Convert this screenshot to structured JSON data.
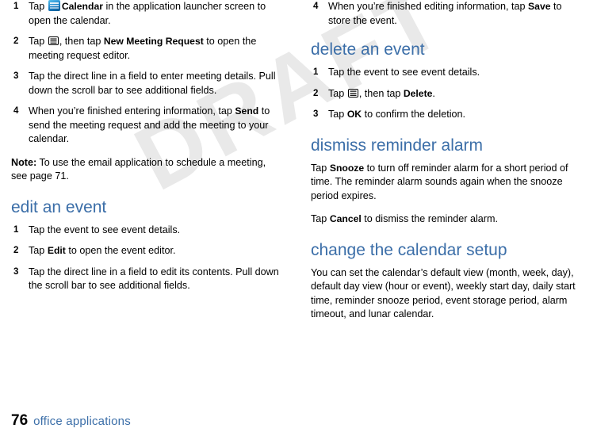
{
  "watermark": "DRAFT",
  "footer": {
    "page_number": "76",
    "label": "office applications"
  },
  "left_column": {
    "steps_schedule_meeting": [
      {
        "num": "1",
        "parts": [
          {
            "t": "Tap ",
            "b": false
          },
          {
            "t": "calendar-icon",
            "b": false,
            "icon": true
          },
          {
            "t": "Calendar",
            "b": true
          },
          {
            "t": " in the application launcher screen to open the calendar.",
            "b": false
          }
        ]
      },
      {
        "num": "2",
        "parts": [
          {
            "t": "Tap ",
            "b": false
          },
          {
            "t": "menu-icon",
            "b": false,
            "menuicon": true
          },
          {
            "t": ", then tap ",
            "b": false
          },
          {
            "t": "New Meeting Request",
            "b": true
          },
          {
            "t": " to open the meeting request editor.",
            "b": false
          }
        ]
      },
      {
        "num": "3",
        "parts": [
          {
            "t": "Tap the direct line in a field to enter meeting details. Pull down the scroll bar to see additional fields.",
            "b": false
          }
        ]
      },
      {
        "num": "4",
        "parts": [
          {
            "t": "When you’re finished entering information, tap ",
            "b": false
          },
          {
            "t": "Send",
            "b": true
          },
          {
            "t": " to send the meeting request and add the meeting to your calendar.",
            "b": false
          }
        ]
      }
    ],
    "note": {
      "label": "Note:",
      "text": " To use the email application to schedule a meeting, see page 71."
    },
    "heading_edit_event": "edit an event",
    "steps_edit_event": [
      {
        "num": "1",
        "parts": [
          {
            "t": "Tap the event to see event details.",
            "b": false
          }
        ]
      },
      {
        "num": "2",
        "parts": [
          {
            "t": "Tap ",
            "b": false
          },
          {
            "t": "Edit",
            "b": true
          },
          {
            "t": " to open the event editor.",
            "b": false
          }
        ]
      },
      {
        "num": "3",
        "parts": [
          {
            "t": "Tap the direct line in a field to edit its contents. Pull down the scroll bar to see additional fields.",
            "b": false
          }
        ]
      }
    ]
  },
  "right_column": {
    "step_save": {
      "num": "4",
      "parts": [
        {
          "t": "When you’re finished editing information, tap ",
          "b": false
        },
        {
          "t": "Save",
          "b": true
        },
        {
          "t": " to store the event.",
          "b": false
        }
      ]
    },
    "heading_delete_event": "delete an event",
    "steps_delete_event": [
      {
        "num": "1",
        "parts": [
          {
            "t": "Tap the event to see event details.",
            "b": false
          }
        ]
      },
      {
        "num": "2",
        "parts": [
          {
            "t": "Tap ",
            "b": false
          },
          {
            "t": "menu-icon",
            "b": false,
            "menuicon": true
          },
          {
            "t": ", then tap ",
            "b": false
          },
          {
            "t": "Delete",
            "b": true
          },
          {
            "t": ".",
            "b": false
          }
        ]
      },
      {
        "num": "3",
        "parts": [
          {
            "t": "Tap ",
            "b": false
          },
          {
            "t": "OK",
            "b": true
          },
          {
            "t": " to confirm the deletion.",
            "b": false
          }
        ]
      }
    ],
    "heading_dismiss_alarm": "dismiss reminder alarm",
    "para_snooze": [
      {
        "t": "Tap ",
        "b": false
      },
      {
        "t": "Snooze",
        "b": true
      },
      {
        "t": " to turn off reminder alarm for a short period of time. The reminder alarm sounds again when the snooze period expires.",
        "b": false
      }
    ],
    "para_cancel": [
      {
        "t": "Tap ",
        "b": false
      },
      {
        "t": "Cancel",
        "b": true
      },
      {
        "t": " to dismiss the reminder alarm.",
        "b": false
      }
    ],
    "heading_change_setup": "change the calendar setup",
    "para_setup": [
      {
        "t": "You can set the calendar’s default view (month, week, day), default day view (hour or event), weekly start day, daily start time, reminder snooze period, event storage period, alarm timeout, and lunar calendar.",
        "b": false
      }
    ]
  }
}
